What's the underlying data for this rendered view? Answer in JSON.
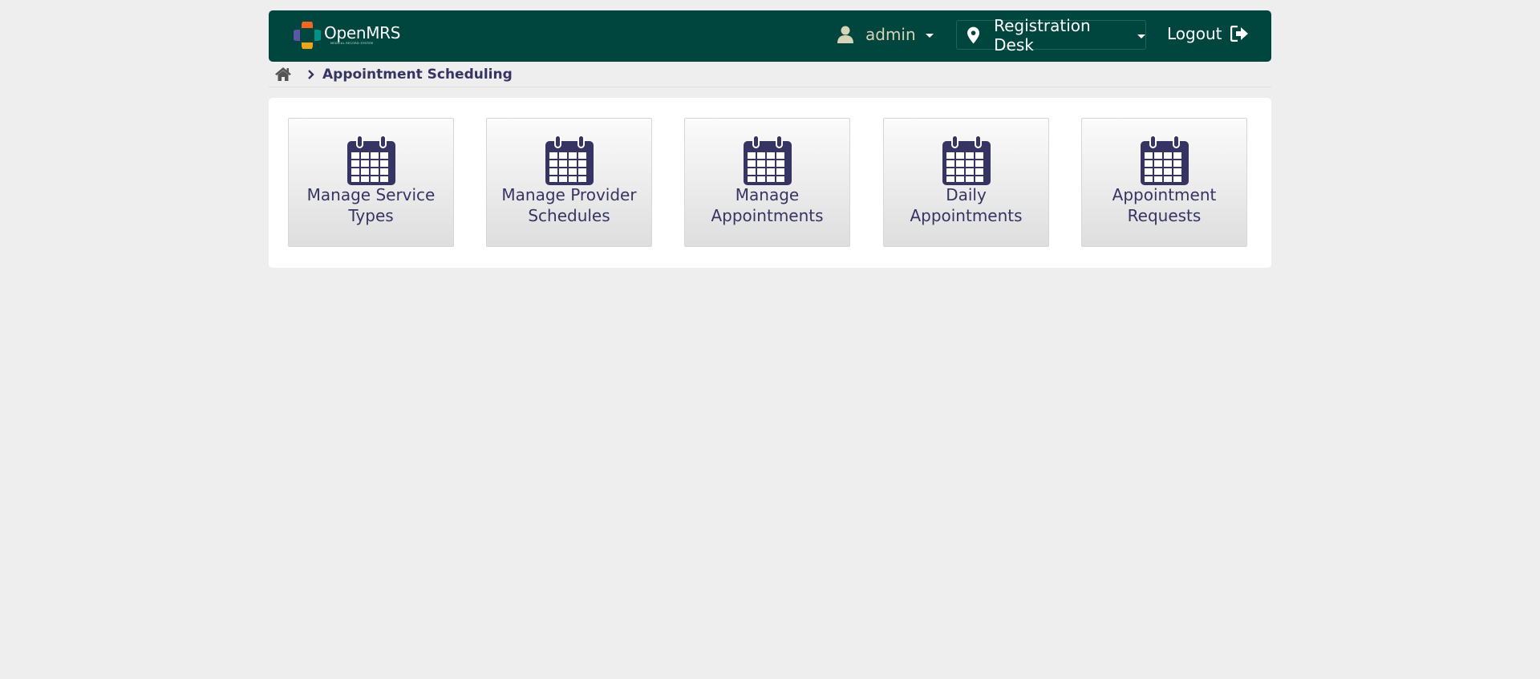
{
  "header": {
    "logo_text": "OpenMRS",
    "logo_tagline": "MEDICAL RECORD SYSTEM",
    "user": {
      "icon": "user-icon",
      "name": "admin"
    },
    "location": {
      "icon": "map-marker-icon",
      "name": "Registration Desk"
    },
    "logout": {
      "label": "Logout",
      "icon": "sign-out-icon"
    }
  },
  "breadcrumb": {
    "home_icon": "home-icon",
    "separator_icon": "chevron-right-icon",
    "current": "Appointment Scheduling"
  },
  "apps": [
    {
      "label": "Manage Service Types",
      "icon": "calendar-icon"
    },
    {
      "label": "Manage Provider Schedules",
      "icon": "calendar-icon"
    },
    {
      "label": "Manage Appointments",
      "icon": "calendar-icon"
    },
    {
      "label": "Daily Appointments",
      "icon": "calendar-icon"
    },
    {
      "label": "Appointment Requests",
      "icon": "calendar-icon"
    }
  ],
  "colors": {
    "header_bg": "#00463f",
    "page_bg": "#eeeeee",
    "text_primary": "#363463",
    "icon_color": "#363463"
  }
}
